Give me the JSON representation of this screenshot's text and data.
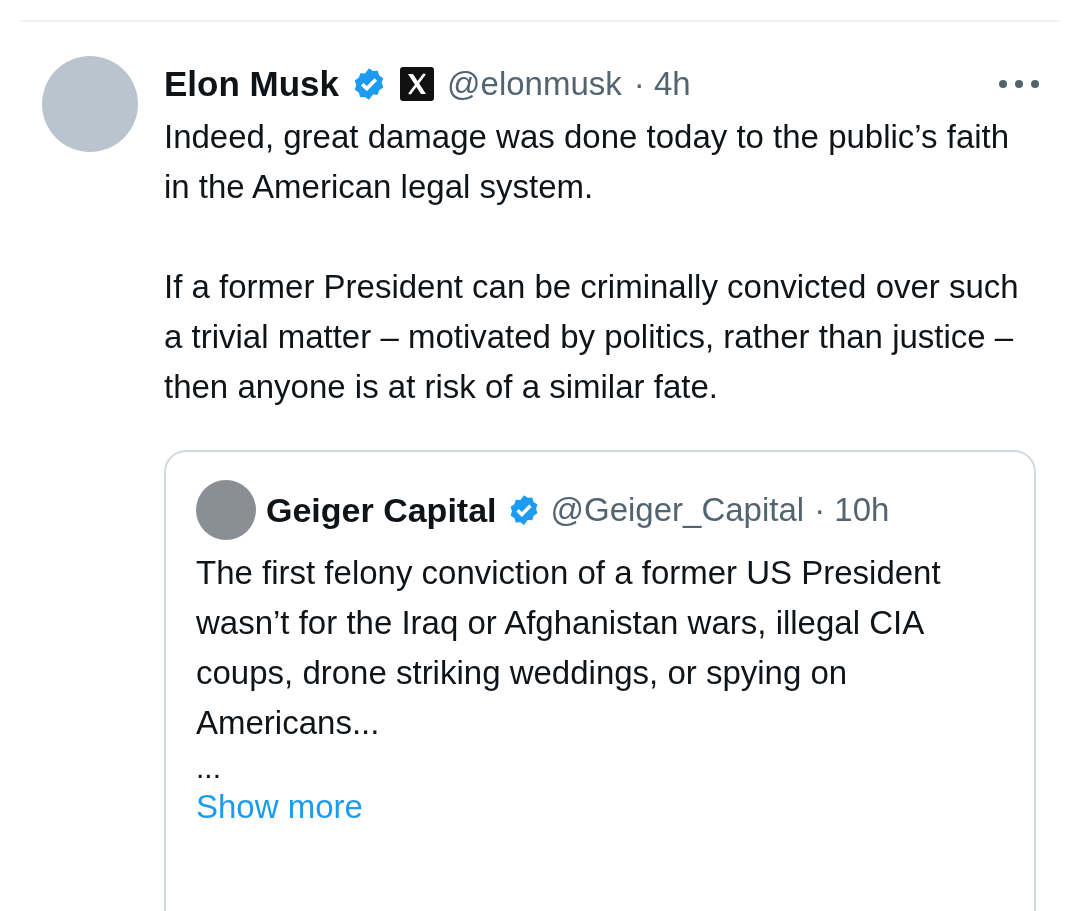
{
  "tweet": {
    "author": {
      "name": "Elon Musk",
      "verified": true,
      "affiliate_badge": true,
      "handle": "@elonmusk",
      "time": "· 4h"
    },
    "paragraphs": [
      "Indeed, great damage was done today to the public’s faith in the American legal system.",
      "If a former President can be criminally convicted over such a trivial matter – motivated by politics, rather than justice – then anyone is at risk of a similar fate."
    ],
    "quoted_tweet": {
      "author": {
        "name": "Geiger Capital",
        "verified": true,
        "handle": "@Geiger_Capital",
        "time": "· 10h"
      },
      "text": "The first felony conviction of a former US President wasn’t for the Iraq or Afghanistan wars, illegal CIA coups, drone striking weddings, or spying on Americans...",
      "ellipsis": "...",
      "show_more": "Show more"
    }
  }
}
